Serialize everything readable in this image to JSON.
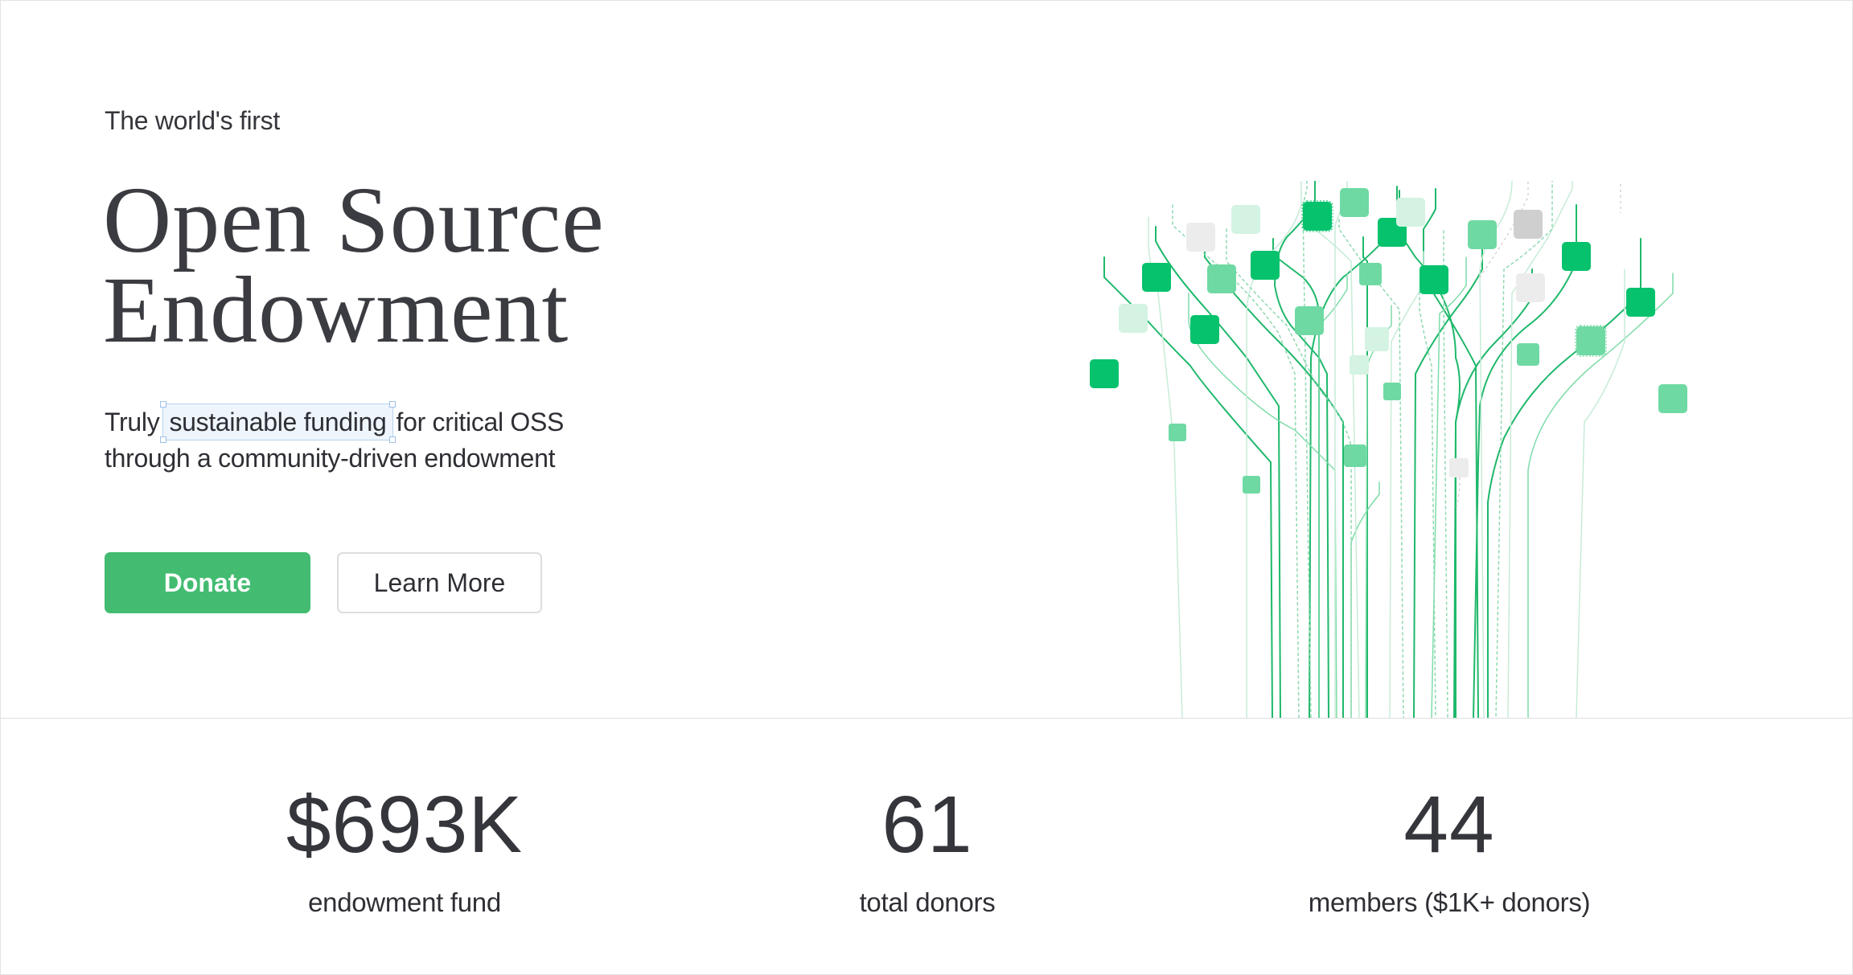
{
  "hero": {
    "eyebrow": "The world's first",
    "title_line1": "Open Source",
    "title_line2": "Endowment",
    "subtitle_prefix": "Truly",
    "subtitle_highlight": "sustainable funding",
    "subtitle_suffix": "for critical OSS",
    "subtitle_line2": "through a community-driven endowment"
  },
  "buttons": {
    "donate": "Donate",
    "learn_more": "Learn More"
  },
  "stats": [
    {
      "value": "$693K",
      "label": "endowment fund"
    },
    {
      "value": "61",
      "label": "total donors"
    },
    {
      "value": "44",
      "label": "members ($1K+ donors)"
    }
  ],
  "colors": {
    "accent_green": "#43bc71",
    "node_bright": "#06c26d",
    "node_mid": "#6fd9a3",
    "node_light": "#d4f3e2",
    "node_gray": "#e9e9e9"
  },
  "illustration": {
    "type": "circuit-tree-graphic"
  }
}
